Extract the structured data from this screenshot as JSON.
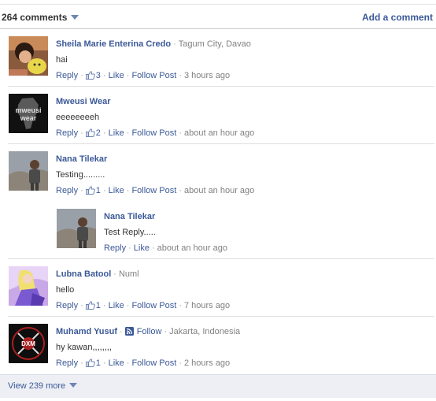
{
  "header": {
    "comment_count": "264 comments",
    "add_comment": "Add a comment"
  },
  "comments": [
    {
      "name": "Sheila Marie Enterina Credo",
      "meta": "Tagum City, Davao",
      "text": "hai",
      "reply": "Reply",
      "likes": "3",
      "like": "Like",
      "follow": "Follow Post",
      "time": "3 hours ago",
      "avatar_icon": "avatar-photo-doll"
    },
    {
      "name": "Mweusi Wear",
      "meta": "",
      "text": "eeeeeeeeh",
      "reply": "Reply",
      "likes": "2",
      "like": "Like",
      "follow": "Follow Post",
      "time": "about an hour ago",
      "avatar_icon": "avatar-africa-logo",
      "avatar_text_1": "mweusi",
      "avatar_text_2": "wear"
    },
    {
      "name": "Nana Tilekar",
      "meta": "",
      "text": "Testing.........",
      "reply": "Reply",
      "likes": "1",
      "like": "Like",
      "follow": "Follow Post",
      "time": "about an hour ago",
      "avatar_icon": "avatar-photo-man"
    },
    {
      "name": "Lubna Batool",
      "meta": "Numl",
      "text": "hello",
      "reply": "Reply",
      "likes": "1",
      "like": "Like",
      "follow": "Follow Post",
      "time": "7 hours ago",
      "avatar_icon": "avatar-anime-art"
    },
    {
      "name": "Muhamd Yusuf",
      "follow_user": "Follow",
      "meta": "Jakarta, Indonesia",
      "text": "hy kawan,,,,,,,,",
      "reply": "Reply",
      "likes": "1",
      "like": "Like",
      "follow": "Follow Post",
      "time": "2 hours ago",
      "avatar_icon": "avatar-emblem-logo",
      "avatar_text": "DXM"
    }
  ],
  "reply_comment": {
    "name": "Nana Tilekar",
    "text": "Test Reply.....",
    "reply": "Reply",
    "like": "Like",
    "time": "about an hour ago",
    "avatar_icon": "avatar-photo-man"
  },
  "footer": {
    "view_more": "View 239 more"
  },
  "colors": {
    "link": "#3b5998",
    "meta": "#808080",
    "footer_bg": "#edeff4"
  }
}
